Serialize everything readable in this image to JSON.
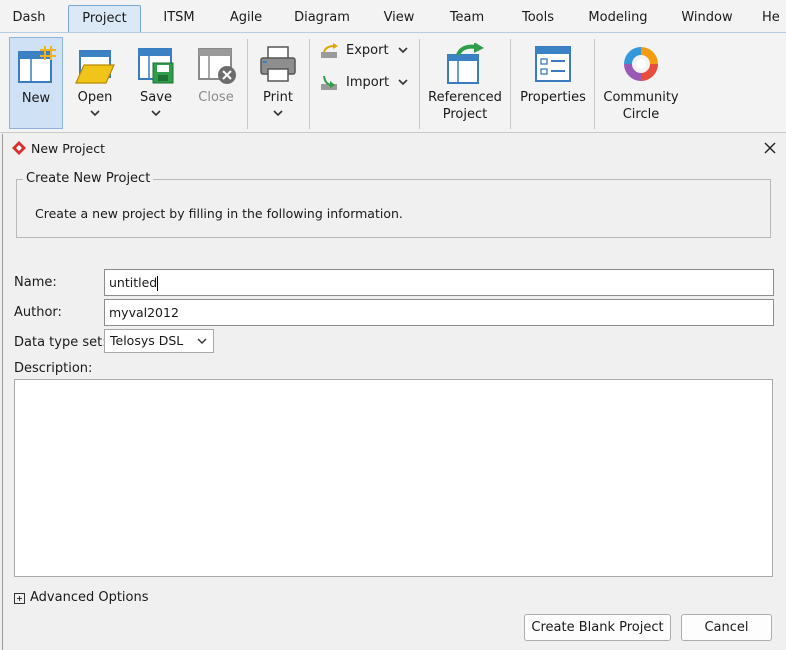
{
  "menu": {
    "tabs": [
      "Dash",
      "Project",
      "ITSM",
      "Agile",
      "Diagram",
      "View",
      "Team",
      "Tools",
      "Modeling",
      "Window",
      "He"
    ],
    "active": "Project"
  },
  "ribbon": {
    "new_label": "New",
    "open_label": "Open",
    "save_label": "Save",
    "close_label": "Close",
    "print_label": "Print",
    "export_label": "Export",
    "import_label": "Import",
    "referenced_line1": "Referenced",
    "referenced_line2": "Project",
    "properties_label": "Properties",
    "community_line1": "Community",
    "community_line2": "Circle"
  },
  "dialog": {
    "title": "New Project",
    "group_title": "Create New Project",
    "group_description": "Create a new project by filling in the following information.",
    "name_label": "Name:",
    "name_value": "untitled",
    "author_label": "Author:",
    "author_value": "myval2012",
    "datatype_label": "Data type set:",
    "datatype_value": "Telosys DSL",
    "description_label": "Description:",
    "description_value": "",
    "advanced_label": "Advanced Options",
    "create_button": "Create Blank Project",
    "cancel_button": "Cancel"
  },
  "colors": {
    "accent": "#cfe2f5",
    "tab_active": "#dbe9f6",
    "icon_blue": "#3b82c4",
    "icon_green": "#2e9e4a"
  }
}
